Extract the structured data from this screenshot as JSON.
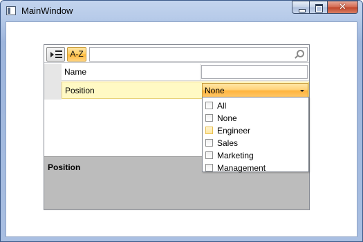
{
  "window": {
    "title": "MainWindow",
    "close_symbol": "✕"
  },
  "toolbar": {
    "sort_alpha_label": "A-Z",
    "search_placeholder": ""
  },
  "properties": [
    {
      "name": "Name",
      "value": ""
    },
    {
      "name": "Position",
      "value": "None"
    }
  ],
  "dropdown": {
    "options": [
      {
        "label": "All",
        "checked": false,
        "highlighted": false
      },
      {
        "label": "None",
        "checked": false,
        "highlighted": false
      },
      {
        "label": "Engineer",
        "checked": false,
        "highlighted": true
      },
      {
        "label": "Sales",
        "checked": false,
        "highlighted": false
      },
      {
        "label": "Marketing",
        "checked": false,
        "highlighted": false
      },
      {
        "label": "Management",
        "checked": false,
        "highlighted": false
      }
    ]
  },
  "description": {
    "title": "Position"
  },
  "colors": {
    "selected_row": "#fff9c4",
    "combo_accent": "#ffb43e",
    "description_bg": "#bcbcbc"
  },
  "icons": [
    "window-app-icon",
    "categorized-sort-icon",
    "search-icon",
    "minimize-icon",
    "maximize-icon",
    "close-icon"
  ]
}
